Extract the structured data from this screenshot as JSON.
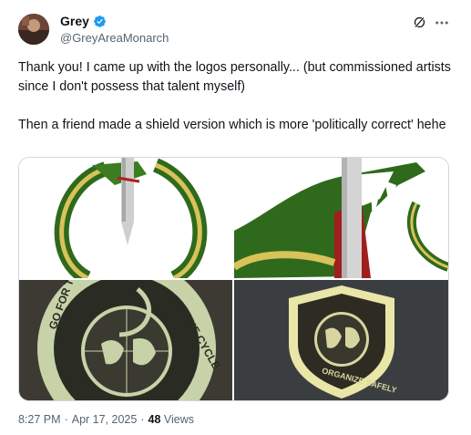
{
  "author": {
    "display_name": "Grey",
    "handle": "@GreyAreaMonarch",
    "verified_color": "#1d9bf0"
  },
  "tweet": {
    "paragraphs": [
      "Thank you! I came up with the logos personally... (but commissioned artists since I don't possess that talent myself)",
      "Then a friend made a shield version which is more 'politically correct' hehe"
    ]
  },
  "media": {
    "images": [
      {
        "name": "logo-snake-sword-circle",
        "badge_text": ""
      },
      {
        "name": "logo-snake-closeup",
        "badge_text": ""
      },
      {
        "name": "patch-go-for-the-break-the-cycle",
        "badge_text": "GO FOR THE · BREAK THE CYCLE · ORGANIZE"
      },
      {
        "name": "patch-shield-organize-safely",
        "badge_text": "ORGANIZE SAFELY"
      }
    ]
  },
  "meta": {
    "time": "8:27 PM",
    "separator1": "·",
    "date": "Apr 17, 2025",
    "separator2": "·",
    "views_count": "48",
    "views_label": "Views"
  },
  "icons": [
    "verified-badge-icon",
    "grok-icon",
    "more-icon"
  ]
}
